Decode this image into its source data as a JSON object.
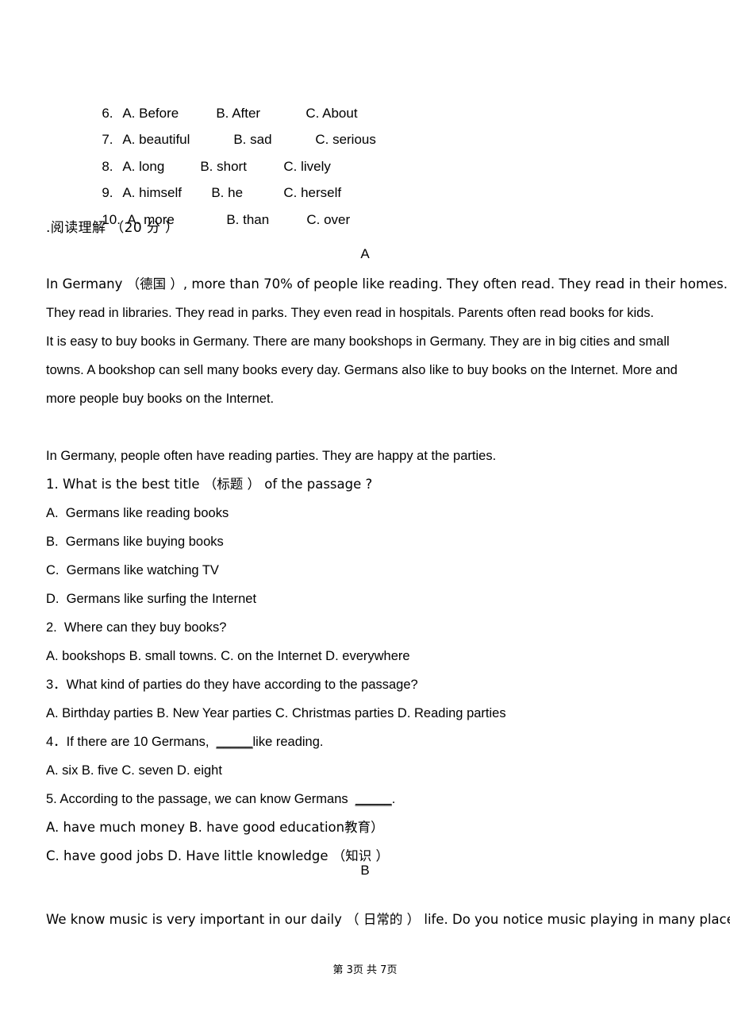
{
  "document": {
    "page_label": "第 3页 共 7页"
  },
  "cloze": {
    "rows": [
      {
        "num": "6.",
        "a": "A. Before",
        "b": "B. After",
        "c": "C. About"
      },
      {
        "num": "7.",
        "a": "A. beautiful",
        "b": "B. sad",
        "c": "C. serious"
      },
      {
        "num": "8.",
        "a": "A. long",
        "b": "B. short",
        "c": "C. lively"
      },
      {
        "num": "9.",
        "a": "A. himself",
        "b": "B. he",
        "c": "C. herself"
      },
      {
        "num": "10.",
        "a": "A. more",
        "b": "B. than",
        "c": "C. over"
      }
    ]
  },
  "section": {
    "heading": ".阅读理解 （20 分 ）"
  },
  "passage_a": {
    "label": "A",
    "lines": [
      "In Germany （德国 ）, more than 70% of people like reading. They often read. They read in their homes.",
      "They read in libraries. They read in parks. They even read in hospitals. Parents often read books for kids.",
      "It is easy to buy books in Germany. There are many bookshops in Germany. They are in big cities and small",
      "towns. A bookshop can sell many books every day. Germans also like to buy books on the Internet. More and",
      "more people buy books on the Internet.",
      "In Germany, people often have reading parties. They are happy at the parties."
    ]
  },
  "questions_a": [
    {
      "type": "stem",
      "text": "1. What is the best title （标题 ） of the passage ?"
    },
    {
      "type": "option",
      "text": "A.  Germans like reading books"
    },
    {
      "type": "option",
      "text": "B.  Germans like buying books"
    },
    {
      "type": "option",
      "text": "C.  Germans like watching TV"
    },
    {
      "type": "option",
      "text": "D.  Germans like surfing the Internet"
    },
    {
      "type": "stem",
      "text": "2.  Where can they buy books?"
    },
    {
      "type": "option",
      "text": "A. bookshops B. small towns. C. on the Internet D. everywhere"
    },
    {
      "type": "stem",
      "text": "3．What kind of parties do they have according to the passage?"
    },
    {
      "type": "option",
      "text": "A. Birthday parties B. New Year parties C. Christmas parties D. Reading parties"
    },
    {
      "type": "blank_stem",
      "pre": "4．If there are 10 Germans,  ",
      "blank": "_____",
      "post": "like reading."
    },
    {
      "type": "option",
      "text": "A. six B. five C. seven D. eight"
    },
    {
      "type": "blank_stem",
      "pre": "5. According to the passage, we can know Germans  ",
      "blank": "_____",
      "post": "."
    },
    {
      "type": "option",
      "text": "A. have much money B. have good education教育）"
    },
    {
      "type": "option",
      "text": "C. have good jobs D. Have little knowledge （知识 ）"
    }
  ],
  "passage_b": {
    "label": "B",
    "lines": [
      "We know music is very important in our daily （ 日常的 ） life. Do you notice music playing in many places?"
    ]
  }
}
